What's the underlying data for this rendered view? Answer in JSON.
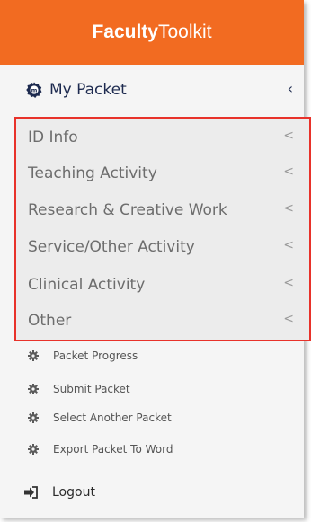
{
  "header": {
    "brand_part1": "Faculty",
    "brand_part2": "Toolkit",
    "background_color": "#f26b21"
  },
  "menu": {
    "my_packet": {
      "label": "My Packet",
      "icon": "packet-badge-icon",
      "chevron": "‹"
    },
    "submenu": {
      "highlight_color": "#e8322a",
      "items": [
        {
          "label": "ID Info",
          "chevron": "<"
        },
        {
          "label": "Teaching Activity",
          "chevron": "<"
        },
        {
          "label": "Research & Creative Work",
          "chevron": "<"
        },
        {
          "label": "Service/Other Activity",
          "chevron": "<"
        },
        {
          "label": "Clinical Activity",
          "chevron": "<"
        },
        {
          "label": "Other",
          "chevron": "<"
        }
      ]
    },
    "actions": [
      {
        "label": "Packet Progress",
        "icon": "gear-icon"
      },
      {
        "label": "Submit Packet",
        "icon": "gear-icon"
      },
      {
        "label": "Select Another Packet",
        "icon": "gear-icon"
      },
      {
        "label": "Export Packet To Word",
        "icon": "gear-icon"
      }
    ],
    "logout": {
      "label": "Logout",
      "icon": "logout-icon"
    }
  }
}
